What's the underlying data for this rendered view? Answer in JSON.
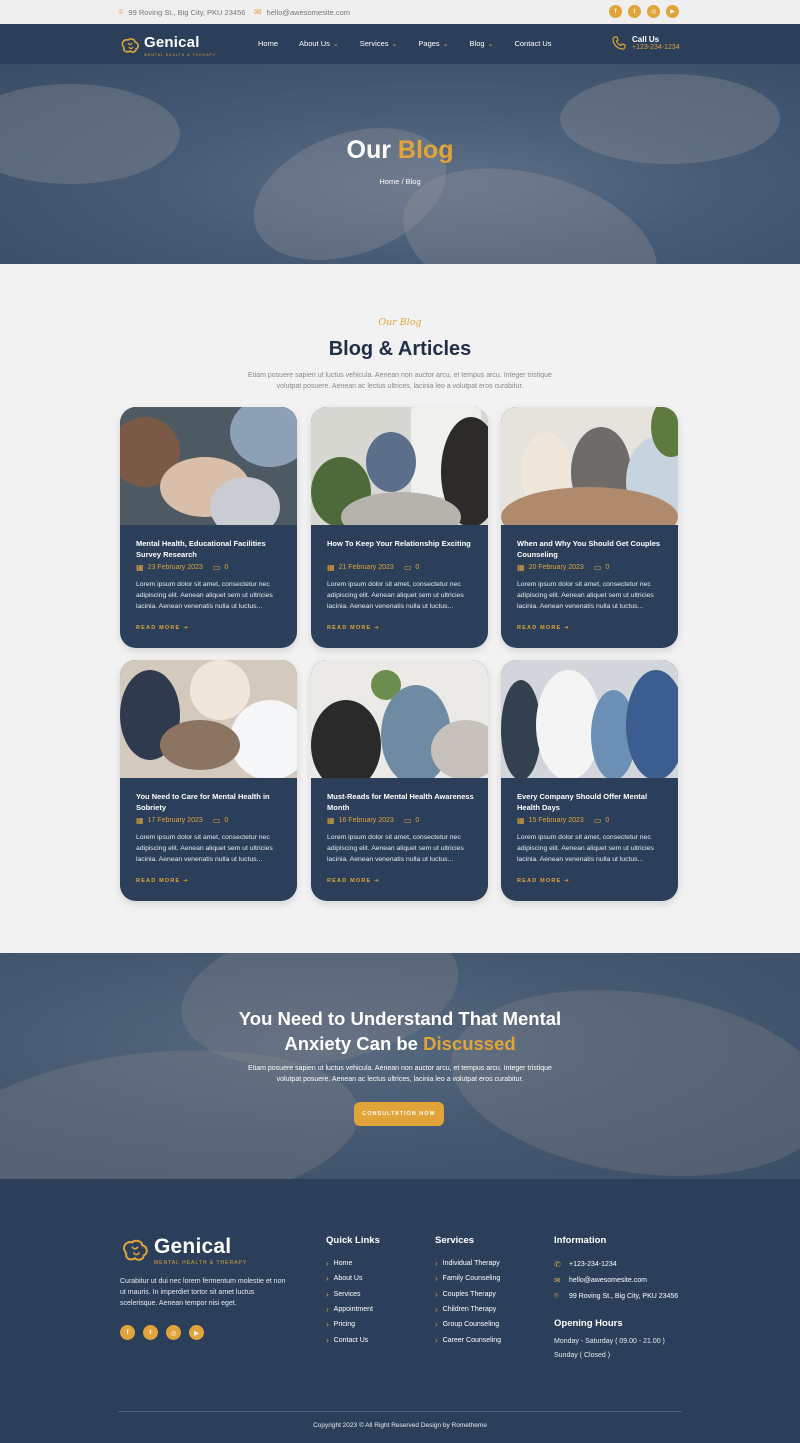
{
  "topbar": {
    "address": "99 Roving St., Big City, PKU 23456",
    "email": "hello@awesomesite.com",
    "socials": [
      "facebook-icon",
      "twitter-icon",
      "instagram-icon",
      "youtube-icon"
    ]
  },
  "brand": {
    "name": "Genical",
    "tagline": "MENTAL HEALTH & THERAPY"
  },
  "nav": {
    "items": [
      {
        "label": "Home",
        "dropdown": false
      },
      {
        "label": "About Us",
        "dropdown": true
      },
      {
        "label": "Services",
        "dropdown": true
      },
      {
        "label": "Pages",
        "dropdown": true
      },
      {
        "label": "Blog",
        "dropdown": true
      },
      {
        "label": "Contact Us",
        "dropdown": false
      }
    ],
    "call_label": "Call Us",
    "call_number": "+123-234-1234"
  },
  "hero": {
    "title_main": "Our",
    "title_accent": "Blog",
    "breadcrumb": "Home / Blog"
  },
  "blog": {
    "kicker": "Our Blog",
    "title": "Blog & Articles",
    "description": "Etiam posuere sapien ut luctus vehicula. Aenean non auctor arcu, et tempus arcu. Integer tristique volutpat posuere. Aenean ac lectus ultrices, lacinia leo a volutpat eros curabitur.",
    "read_more": "READ MORE",
    "posts": [
      {
        "title": "Mental Health, Educational Facilities Survey Research",
        "date": "23 February 2023",
        "comments": "0",
        "excerpt": "Lorem ipsum dolor sit amet, consectetur nec adipiscing elit. Aenean aliquet sem ut ultricies lacinia. Aenean venenatis nulla ut luctus..."
      },
      {
        "title": "How To Keep Your Relationship Exciting",
        "date": "21 February 2023",
        "comments": "0",
        "excerpt": "Lorem ipsum dolor sit amet, consectetur nec adipiscing elit. Aenean aliquet sem ut ultricies lacinia. Aenean venenatis nulla ut luctus..."
      },
      {
        "title": "When and Why You Should Get Couples Counseling",
        "date": "20 February 2023",
        "comments": "0",
        "excerpt": "Lorem ipsum dolor sit amet, consectetur nec adipiscing elit. Aenean aliquet sem ut ultricies lacinia. Aenean venenatis nulla ut luctus..."
      },
      {
        "title": "You Need to Care for Mental Health in Sobriety",
        "date": "17 February 2023",
        "comments": "0",
        "excerpt": "Lorem ipsum dolor sit amet, consectetur nec adipiscing elit. Aenean aliquet sem ut ultricies lacinia. Aenean venenatis nulla ut luctus..."
      },
      {
        "title": "Must-Reads for Mental Health Awareness Month",
        "date": "16 February 2023",
        "comments": "0",
        "excerpt": "Lorem ipsum dolor sit amet, consectetur nec adipiscing elit. Aenean aliquet sem ut ultricies lacinia. Aenean venenatis nulla ut luctus..."
      },
      {
        "title": "Every Company Should Offer Mental Health Days",
        "date": "15 February 2023",
        "comments": "0",
        "excerpt": "Lorem ipsum dolor sit amet, consectetur nec adipiscing elit. Aenean aliquet sem ut ultricies lacinia. Aenean venenatis nulla ut luctus..."
      }
    ]
  },
  "cta": {
    "title_line1": "You Need to Understand That Mental",
    "title_line2_main": "Anxiety Can be",
    "title_line2_accent": "Discussed",
    "description": "Etiam posuere sapien ut luctus vehicula. Aenean non auctor arcu, et tempus arcu. Integer tristique volutpat posuere. Aenean ac lectus ultrices, lacinia leo a volutpat eros curabitur.",
    "button": "CONSULTATION NOW"
  },
  "footer": {
    "about": "Curabitur ut dui nec lorem fermentum molestie  et non ut mauris. In imperdiet tortor sit amet luctus scelerisque. Aenean tempor nisi eget.",
    "quick_links_title": "Quick Links",
    "quick_links": [
      "Home",
      "About Us",
      "Services",
      "Appointment",
      "Pricing",
      "Contact Us"
    ],
    "services_title": "Services",
    "services": [
      "Individual Therapy",
      "Family Counseling",
      "Couples Therapy",
      "Children Therapy",
      "Group Counseling",
      "Career Counseling"
    ],
    "info_title": "Information",
    "phone": "+123-234-1234",
    "email": "hello@awesomesite.com",
    "address": "99 Roving St., Big City, PKU 23456",
    "hours_title": "Opening Hours",
    "hours": [
      "Monday - Saturday ( 09.00 - 21.00 )",
      "Sunday ( Closed )"
    ],
    "copyright": "Copyright 2023 © All Right Reserved Design by Rometheme"
  },
  "colors": {
    "navy": "#2b3f5a",
    "gold": "#e0a43a",
    "background": "#f2f2f2"
  }
}
